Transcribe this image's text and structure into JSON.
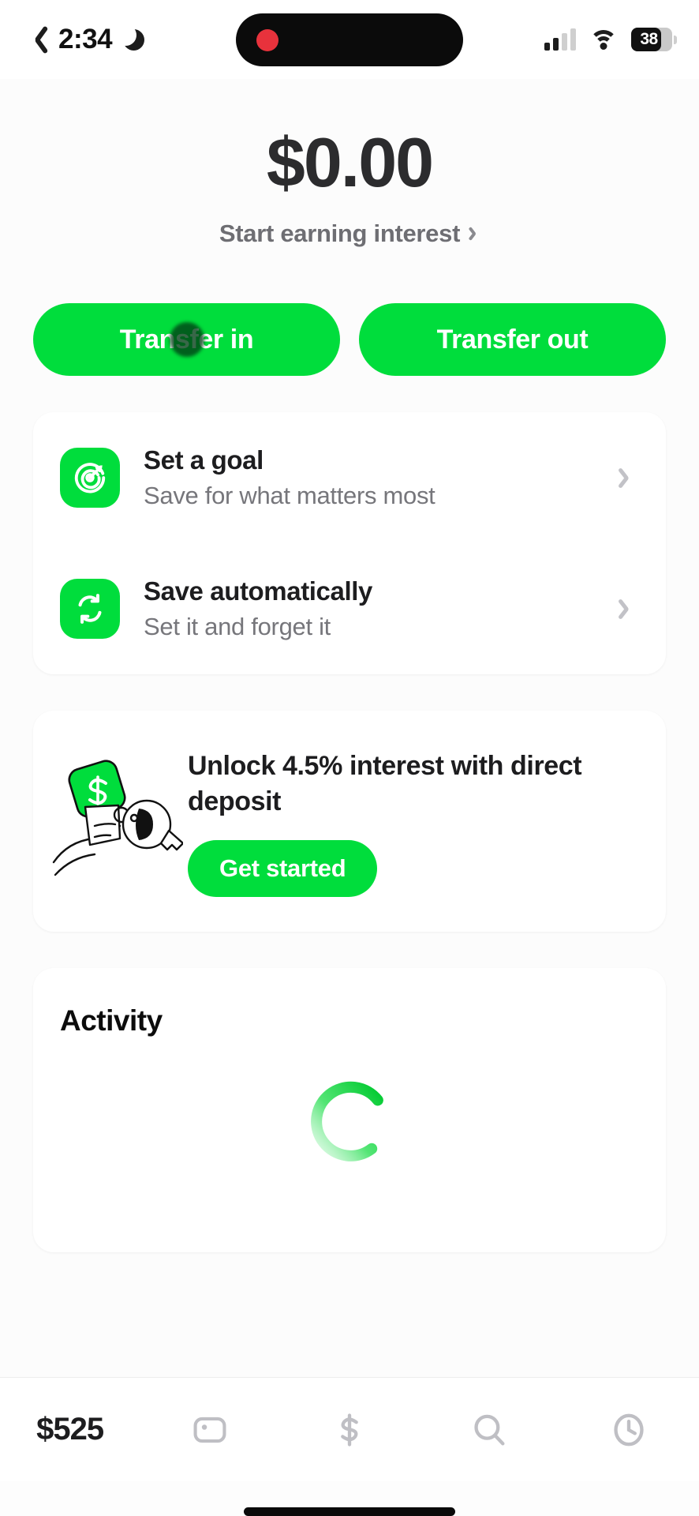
{
  "status_bar": {
    "back_icon": "back-chevron-icon",
    "time": "2:34",
    "dnd_icon": "crescent-moon-icon",
    "recording_indicator": "record-dot-icon",
    "signal_icon": "cellular-signal-icon",
    "wifi_icon": "wifi-icon",
    "battery_percent": "38"
  },
  "savings": {
    "balance": "$0.00",
    "interest_link": "Start earning interest",
    "interest_chevron": "chevron-right-icon"
  },
  "actions": {
    "transfer_in": "Transfer in",
    "transfer_out": "Transfer out"
  },
  "options_card": {
    "rows": [
      {
        "icon": "target-goal-icon",
        "title": "Set a goal",
        "subtitle": "Save for what matters most",
        "chevron": "chevron-right-icon"
      },
      {
        "icon": "auto-repeat-icon",
        "title": "Save automatically",
        "subtitle": "Set it and forget it",
        "chevron": "chevron-right-icon"
      }
    ]
  },
  "promo_card": {
    "illustration": "hand-holding-cash-tag-and-key-illustration",
    "title": "Unlock 4.5% interest with direct deposit",
    "button_label": "Get started"
  },
  "activity_card": {
    "title": "Activity",
    "loading_indicator": "loading-spinner-icon"
  },
  "tab_bar": {
    "items": [
      {
        "label": "$525",
        "icon": "balance-tab"
      },
      {
        "label": "",
        "icon": "card-icon"
      },
      {
        "label": "",
        "icon": "dollar-icon"
      },
      {
        "label": "",
        "icon": "search-icon"
      },
      {
        "label": "",
        "icon": "clock-history-icon"
      }
    ]
  },
  "colors": {
    "brand_green": "#00DD3C",
    "text_primary": "#1D1D1F",
    "text_secondary": "#76767B",
    "page_background": "#FCFCFC"
  }
}
